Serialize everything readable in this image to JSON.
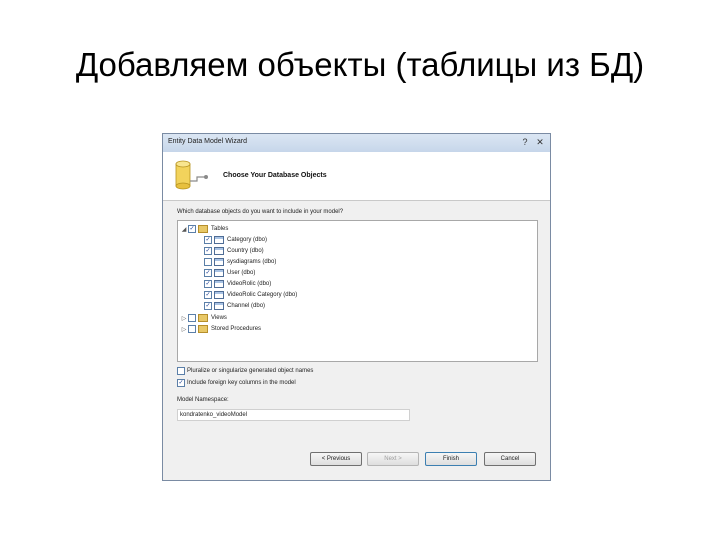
{
  "slide": {
    "title": "Добавляем объекты (таблицы из БД)"
  },
  "window": {
    "title": "Entity Data Model Wizard",
    "controls": {
      "help": "?",
      "close": "✕"
    }
  },
  "header": {
    "heading": "Choose Your Database Objects",
    "icon": "database-icon"
  },
  "question": "Which database objects do you want to include in your model?",
  "tree": {
    "root": {
      "label": "Tables",
      "expander": "◢",
      "checked": "✓"
    },
    "tables": [
      {
        "label": "Category (dbo)",
        "checked": "✓"
      },
      {
        "label": "Country (dbo)",
        "checked": "✓"
      },
      {
        "label": "sysdiagrams (dbo)",
        "checked": ""
      },
      {
        "label": "User (dbo)",
        "checked": "✓"
      },
      {
        "label": "VideoRolic (dbo)",
        "checked": "✓"
      },
      {
        "label": "VideoRolic Category (dbo)",
        "checked": "✓"
      },
      {
        "label": "Channel (dbo)",
        "checked": "✓"
      }
    ],
    "views": {
      "label": "Views",
      "expander": "▷",
      "checked": ""
    },
    "procedures": {
      "label": "Stored Procedures",
      "expander": "▷",
      "checked": ""
    }
  },
  "options": {
    "pluralize": {
      "label": "Pluralize or singularize generated object names",
      "checked": ""
    },
    "foreign_keys": {
      "label": "Include foreign key columns in the model",
      "checked": "✓"
    }
  },
  "namespace": {
    "label": "Model Namespace:",
    "value": "kondratenko_videoModel"
  },
  "buttons": {
    "previous": "< Previous",
    "next": "Next >",
    "finish": "Finish",
    "cancel": "Cancel"
  }
}
